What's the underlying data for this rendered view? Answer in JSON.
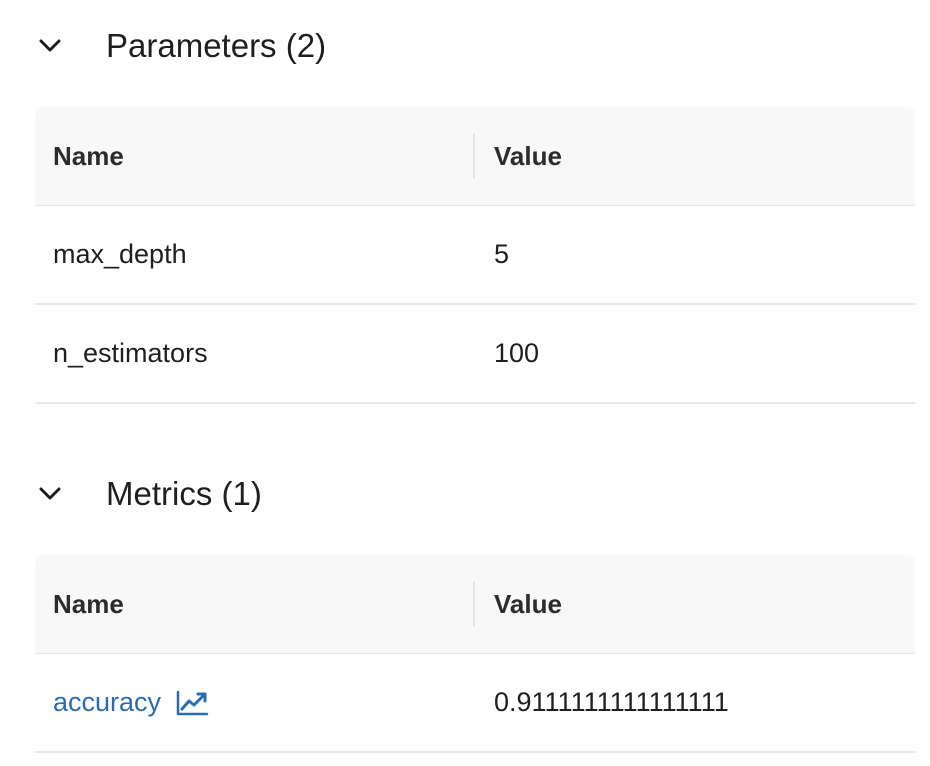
{
  "parameters": {
    "title": "Parameters (2)",
    "columns": {
      "name": "Name",
      "value": "Value"
    },
    "rows": [
      {
        "name": "max_depth",
        "value": "5"
      },
      {
        "name": "n_estimators",
        "value": "100"
      }
    ]
  },
  "metrics": {
    "title": "Metrics (1)",
    "columns": {
      "name": "Name",
      "value": "Value"
    },
    "rows": [
      {
        "name": "accuracy",
        "value": "0.9111111111111111",
        "icon": "line-chart-icon"
      }
    ]
  },
  "colors": {
    "link": "#2a6cb3",
    "header_bg": "#f8f8f8",
    "border": "#e8e8e8"
  }
}
